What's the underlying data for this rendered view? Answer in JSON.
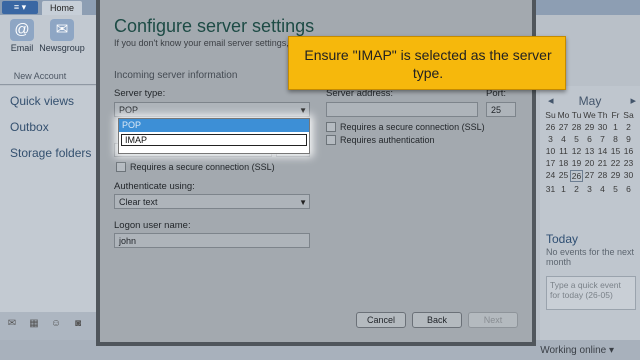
{
  "ribbon": {
    "app_button": "≡ ▾",
    "tab_home": "Home",
    "buttons": [
      {
        "label": "Email",
        "icon": "email-icon",
        "glyph": "@"
      },
      {
        "label": "Newsgroup",
        "icon": "newsgroup-icon",
        "glyph": "✉"
      }
    ],
    "group_label": "New Account"
  },
  "nav": {
    "items": [
      "Quick views",
      "Outbox",
      "Storage folders"
    ]
  },
  "bottom_icons": [
    "mail-icon",
    "calendar-icon",
    "contacts-icon",
    "feeds-icon",
    "newsgroups-icon"
  ],
  "status": {
    "text": "Working online ▾"
  },
  "calendar": {
    "month": "May",
    "prev": "◂",
    "next": "▸",
    "days_header": [
      "Su",
      "Mo",
      "Tu",
      "We",
      "Th",
      "Fr",
      "Sa"
    ],
    "weeks": [
      [
        "26",
        "27",
        "28",
        "29",
        "30",
        "1",
        "2"
      ],
      [
        "3",
        "4",
        "5",
        "6",
        "7",
        "8",
        "9"
      ],
      [
        "10",
        "11",
        "12",
        "13",
        "14",
        "15",
        "16"
      ],
      [
        "17",
        "18",
        "19",
        "20",
        "21",
        "22",
        "23"
      ],
      [
        "24",
        "25",
        "26",
        "27",
        "28",
        "29",
        "30"
      ],
      [
        "31",
        "1",
        "2",
        "3",
        "4",
        "5",
        "6"
      ]
    ],
    "today_label": "Today",
    "today_sub": "No events for the next month",
    "quick_event_placeholder": "Type a quick event for today (26-05)"
  },
  "dialog": {
    "title": "Configure server settings",
    "subtitle": "If you don't know your email server settings, co",
    "incoming_header": "Incoming server information",
    "server_type_label": "Server type:",
    "server_type_value": "POP",
    "server_type_options": [
      "POP",
      "IMAP"
    ],
    "server_address_label": "Server address:",
    "server_address_value": "",
    "port_label": "Port:",
    "port_value": "25",
    "secure_conn_right": "Requires a secure connection (SSL)",
    "requires_auth": "Requires authentication",
    "secure_conn_left": "Requires a secure connection (SSL)",
    "authenticate_label": "Authenticate using:",
    "authenticate_value": "Clear text",
    "logon_label": "Logon user name:",
    "logon_value": "john",
    "buttons": {
      "cancel": "Cancel",
      "back": "Back",
      "next": "Next"
    }
  },
  "callout": {
    "text": "Ensure \"IMAP\" is selected as the server type."
  },
  "colors": {
    "callout": "#f6b80c",
    "dropdown_selected": "#3d8fd6",
    "dialog_title": "#1d4b45"
  }
}
